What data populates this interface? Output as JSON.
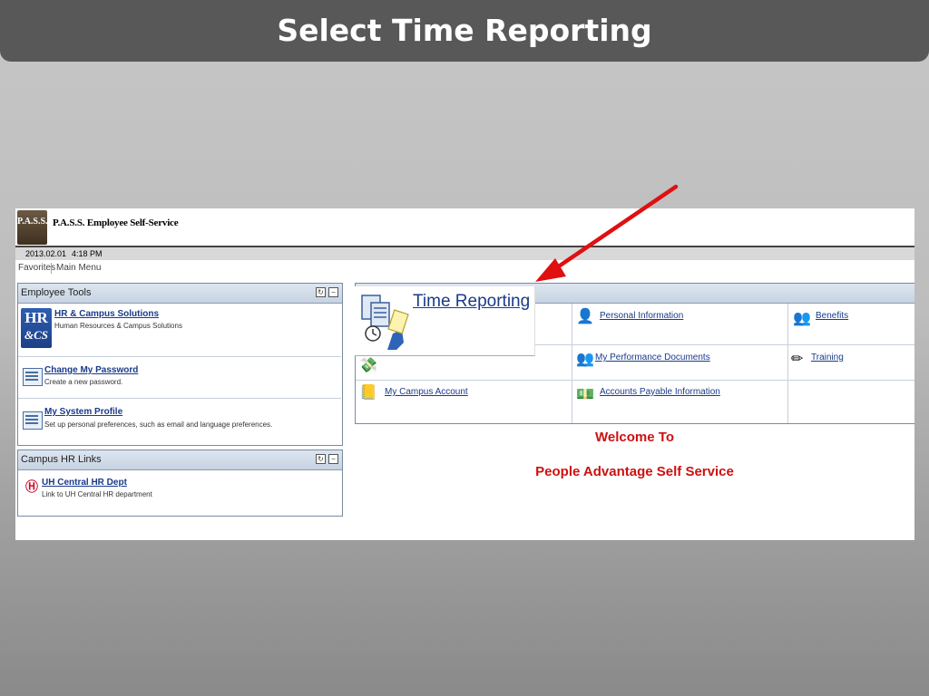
{
  "slide": {
    "title": "Select Time Reporting"
  },
  "app": {
    "logo_text": "P.A.S.S.",
    "title": "P.A.S.S. Employee Self-Service",
    "date": "2013.02.01",
    "time": "4:18 PM",
    "nav": {
      "favorites": "Favorites",
      "main_menu": "Main Menu"
    }
  },
  "employee_tools": {
    "title": "Employee Tools",
    "items": [
      {
        "label": "HR & Campus Solutions",
        "desc": "Human Resources & Campus Solutions",
        "icon": "hr-cs-icon",
        "icon_text_top": "HR",
        "icon_text_bottom": "&CS"
      },
      {
        "label": "Change My Password",
        "desc": "Create a new password.",
        "icon": "document-icon"
      },
      {
        "label": "My System Profile",
        "desc": "Set up personal preferences, such as email and language preferences.",
        "icon": "document-icon"
      }
    ]
  },
  "campus_hr_links": {
    "title": "Campus HR Links",
    "items": [
      {
        "label": "UH Central HR Dept",
        "desc": "Link to UH Central HR department",
        "icon": "uh-logo-icon"
      }
    ]
  },
  "navigation": {
    "items": [
      {
        "label": "Personal Information",
        "icon": "person-icon"
      },
      {
        "label": "Benefits",
        "icon": "people-icon"
      },
      {
        "label": "My Performance Documents",
        "icon": "people-icon"
      },
      {
        "label": "Training",
        "icon": "pencil-icon"
      },
      {
        "label": "My Campus Account",
        "icon": "book-icon"
      },
      {
        "label": "Accounts Payable Information",
        "icon": "money-icon"
      }
    ]
  },
  "time_reporting": {
    "label": "Time Reporting",
    "icon": "timesheet-icon"
  },
  "welcome": {
    "line1": "Welcome To",
    "line2": "People Advantage Self Service"
  },
  "colors": {
    "link": "#1a3a8a",
    "welcome": "#cc1111",
    "arrow": "#e01010",
    "title_bar": "#585858"
  }
}
